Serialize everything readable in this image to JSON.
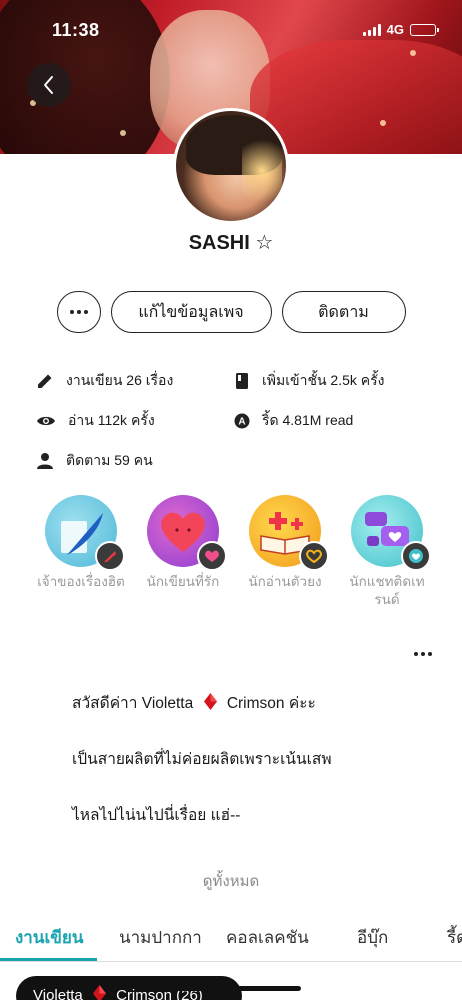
{
  "status_bar": {
    "time": "11:38",
    "network": "4G"
  },
  "profile": {
    "name": "SASHI ☆"
  },
  "actions": {
    "edit_label": "แก้ไขข้อมูลเพจ",
    "follow_label": "ติดตาม"
  },
  "stats": {
    "works": "งานเขียน 26 เรื่อง",
    "library_adds": "เพิ่มเข้าชั้น 2.5k ครั้ง",
    "reads": "อ่าน 112k ครั้ง",
    "chat_reads": "ริ้ด 4.81M read",
    "followers": "ติดตาม 59 คน"
  },
  "badges": [
    {
      "label": "เจ้าของเรื่องฮิต",
      "icon": "feather-pen-icon",
      "color": "#4db8d8"
    },
    {
      "label": "นักเขียนที่รัก",
      "icon": "heart-icon",
      "color": "#c23fa6"
    },
    {
      "label": "นักอ่านตัวยง",
      "icon": "open-book-icon",
      "color": "#f2b21a"
    },
    {
      "label": "นักแชทติดเทรนด์",
      "icon": "chat-bubble-icon",
      "color": "#3ec0c8"
    }
  ],
  "bio": {
    "line1_prefix": "สวัสดีค่าา Violetta",
    "line1_suffix": "Crimson ค่ะะ",
    "line2": "เป็นสายผลิตที่ไม่ค่อยผลิตเพราะเน้นเสพ",
    "line3": "ไหลไปไน่นไปนี่เรื่อย แฮ่--"
  },
  "see_all": "ดูทั้งหมด",
  "tabs": [
    {
      "label": "งานเขียน",
      "active": true
    },
    {
      "label": "นามปากกา",
      "active": false
    },
    {
      "label": "คอลเลคชัน",
      "active": false
    },
    {
      "label": "อีบุ๊ก",
      "active": false
    },
    {
      "label": "รี้ด",
      "active": false
    }
  ],
  "penname_chip": {
    "prefix": "Violetta",
    "suffix": "Crimson (26)"
  },
  "colors": {
    "accent": "#1aa3b0",
    "gem": "#d4141c"
  }
}
